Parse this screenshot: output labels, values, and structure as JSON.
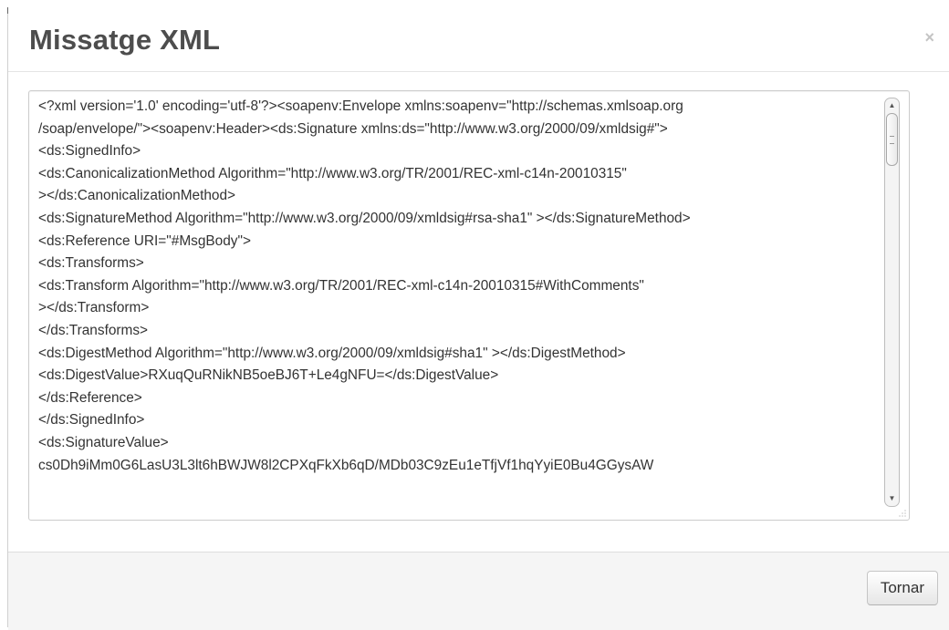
{
  "modal": {
    "title": "Missatge XML",
    "close_label": "×",
    "xml_content": "<?xml version='1.0' encoding='utf-8'?><soapenv:Envelope xmlns:soapenv=\"http://schemas.xmlsoap.org\n/soap/envelope/\"><soapenv:Header><ds:Signature xmlns:ds=\"http://www.w3.org/2000/09/xmldsig#\">\n<ds:SignedInfo>\n<ds:CanonicalizationMethod Algorithm=\"http://www.w3.org/TR/2001/REC-xml-c14n-20010315\"\n></ds:CanonicalizationMethod>\n<ds:SignatureMethod Algorithm=\"http://www.w3.org/2000/09/xmldsig#rsa-sha1\" ></ds:SignatureMethod>\n<ds:Reference URI=\"#MsgBody\">\n<ds:Transforms>\n<ds:Transform Algorithm=\"http://www.w3.org/TR/2001/REC-xml-c14n-20010315#WithComments\"\n></ds:Transform>\n</ds:Transforms>\n<ds:DigestMethod Algorithm=\"http://www.w3.org/2000/09/xmldsig#sha1\" ></ds:DigestMethod>\n<ds:DigestValue>RXuqQuRNikNB5oeBJ6T+Le4gNFU=</ds:DigestValue>\n</ds:Reference>\n</ds:SignedInfo>\n<ds:SignatureValue>\ncs0Dh9iMm0G6LasU3L3lt6hBWJW8l2CPXqFkXb6qD/MDb03C9zEu1eTfjVf1hqYyiE0Bu4GGysAW",
    "return_button_label": "Tornar"
  },
  "icons": {
    "scroll_up": "▲",
    "scroll_down": "▼"
  }
}
